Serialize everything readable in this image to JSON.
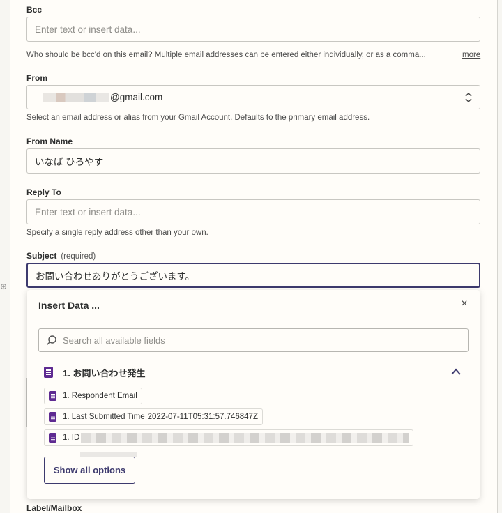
{
  "bcc": {
    "label": "Bcc",
    "placeholder": "Enter text or insert data...",
    "help": "Who should be bcc'd on this email? Multiple email addresses can be entered either individually, or as a comma...",
    "more": "more"
  },
  "from": {
    "label": "From",
    "value_suffix": "@gmail.com",
    "help": "Select an email address or alias from your Gmail Account. Defaults to the primary email address."
  },
  "from_name": {
    "label": "From Name",
    "value": "いなば ひろやす"
  },
  "reply_to": {
    "label": "Reply To",
    "placeholder": "Enter text or insert data...",
    "help": "Specify a single reply address other than your own."
  },
  "subject": {
    "label": "Subject",
    "required": "(required)",
    "value": "お問い合わせありがとうございます。"
  },
  "insert_data": {
    "title": "Insert Data ...",
    "close": "×",
    "search_placeholder": "Search all available fields",
    "app_step": "1. お問い合わせ発生",
    "fields": [
      {
        "label": "1. Respondent Email",
        "value": ""
      },
      {
        "label": "1. Last Submitted Time",
        "value": "2022-07-11T05:31:57.746847Z"
      },
      {
        "label": "1. ID",
        "value": ""
      }
    ],
    "show_all": "Show all options"
  },
  "label_mailbox": {
    "label": "Label/Mailbox"
  },
  "edge": {
    "left_glyph": "⊕",
    "right_glyph": "e"
  },
  "colors": {
    "accent": "#3d3a6e",
    "google_forms": "#5e2a91",
    "background": "#fffdf9"
  },
  "icons": {
    "search": "search-icon",
    "close": "close-icon",
    "select": "chevron-up-down-icon",
    "collapse": "chevron-up-icon",
    "app": "google-forms-icon"
  }
}
